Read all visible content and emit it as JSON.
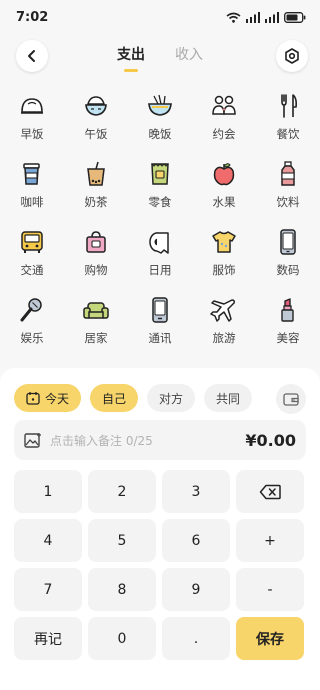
{
  "status_bar": {
    "time": "7:02"
  },
  "header": {
    "tabs": [
      {
        "label": "支出"
      },
      {
        "label": "收入"
      }
    ]
  },
  "categories": [
    {
      "label": "早饭",
      "icon": "bun-icon"
    },
    {
      "label": "午饭",
      "icon": "rice-bowl-icon"
    },
    {
      "label": "晚饭",
      "icon": "noodle-bowl-icon"
    },
    {
      "label": "约会",
      "icon": "couple-icon"
    },
    {
      "label": "餐饮",
      "icon": "fork-knife-icon"
    },
    {
      "label": "咖啡",
      "icon": "coffee-cup-icon"
    },
    {
      "label": "奶茶",
      "icon": "milk-tea-icon"
    },
    {
      "label": "零食",
      "icon": "snack-bag-icon"
    },
    {
      "label": "水果",
      "icon": "apple-icon"
    },
    {
      "label": "饮料",
      "icon": "drink-bottle-icon"
    },
    {
      "label": "交通",
      "icon": "bus-icon"
    },
    {
      "label": "购物",
      "icon": "shopping-bag-icon"
    },
    {
      "label": "日用",
      "icon": "tissue-roll-icon"
    },
    {
      "label": "服饰",
      "icon": "tshirt-icon"
    },
    {
      "label": "数码",
      "icon": "phone-icon"
    },
    {
      "label": "娱乐",
      "icon": "microphone-icon"
    },
    {
      "label": "居家",
      "icon": "sofa-icon"
    },
    {
      "label": "通讯",
      "icon": "mobile-icon"
    },
    {
      "label": "旅游",
      "icon": "airplane-icon"
    },
    {
      "label": "美容",
      "icon": "lipstick-icon"
    }
  ],
  "chips": [
    {
      "label": "今天"
    },
    {
      "label": "自己"
    },
    {
      "label": "对方"
    },
    {
      "label": "共同"
    }
  ],
  "note": {
    "placeholder": "点击输入备注 0/25",
    "amount": "¥0.00"
  },
  "keypad": [
    [
      "1",
      "2",
      "3",
      "⌫"
    ],
    [
      "4",
      "5",
      "6",
      "+"
    ],
    [
      "7",
      "8",
      "9",
      "-"
    ],
    [
      "再记",
      "0",
      ".",
      "保存"
    ]
  ],
  "colors": {
    "accent": "#f7d56a",
    "tab_underline": "#f7c948"
  }
}
